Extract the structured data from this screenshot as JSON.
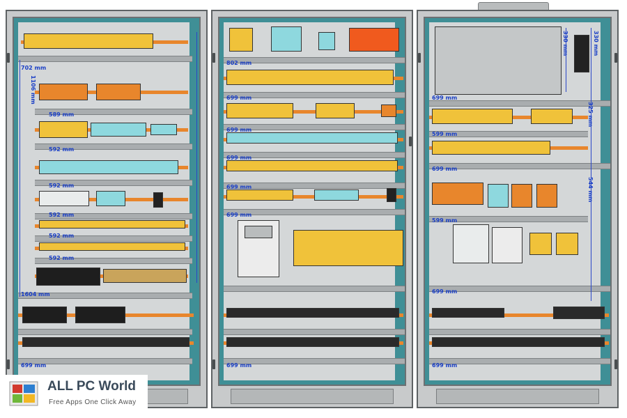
{
  "dimensions": {
    "left": [
      "702 mm",
      "1106 mm",
      "589 mm",
      "592 mm",
      "592 mm",
      "592 mm",
      "592 mm",
      "592 mm",
      "1604 mm",
      "699 mm"
    ],
    "middle": [
      "802 mm",
      "699 mm",
      "699 mm",
      "699 mm",
      "699 mm",
      "699 mm",
      "699 mm"
    ],
    "right": [
      "330 mm",
      "330 mm",
      "699 mm",
      "599 mm",
      "699 mm",
      "599 mm",
      "699 mm",
      "699 mm",
      "325 mm",
      "544 mm"
    ]
  },
  "watermark": {
    "title": "ALL PC World",
    "tagline": "Free Apps One Click Away"
  },
  "colors": {
    "background": "#3f8f96",
    "rail": "#e8862c",
    "dimension": "#1a3fc6",
    "cabinet": "#c8cacb"
  }
}
